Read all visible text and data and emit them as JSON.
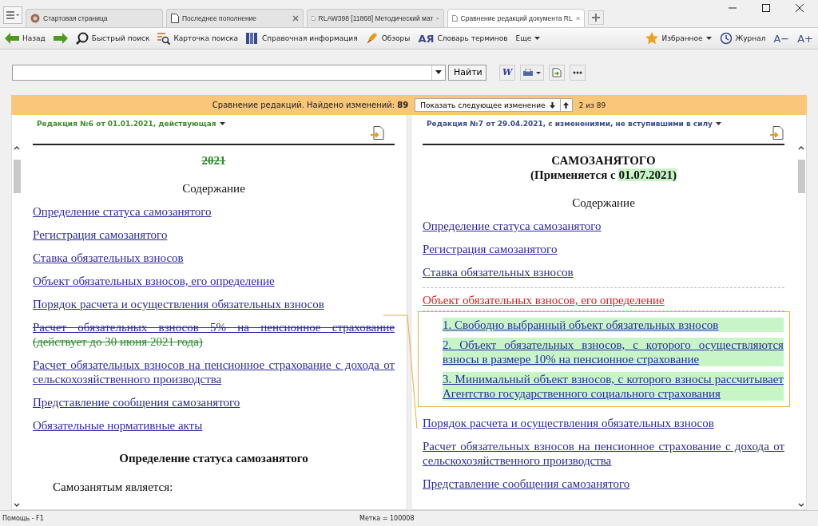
{
  "tabs": [
    {
      "label": "Стартовая страница",
      "kind": "home",
      "closable": false,
      "selected": false
    },
    {
      "label": "Последнее пополнение",
      "kind": "document",
      "closable": true,
      "selected": false
    },
    {
      "label": "RLAW398 [11868] Методический мат",
      "kind": "document",
      "closable": true,
      "selected": false
    },
    {
      "label": "Сравнение редакций документа RL",
      "kind": "document",
      "closable": true,
      "selected": true
    }
  ],
  "toolbar": {
    "left": [
      {
        "label": "Назад"
      },
      {
        "label": "Быстрый поиск"
      },
      {
        "label": "Карточка поиска"
      },
      {
        "label": "Справочная информация"
      },
      {
        "label": "Обзоры"
      },
      {
        "glyph": "АЯ",
        "label": "Словарь терминов"
      },
      {
        "label": "Еще"
      }
    ],
    "right": [
      {
        "label": "Избранное",
        "dropdown": true
      },
      {
        "label": "Журнал",
        "dropdown": false
      },
      {
        "label": "A−",
        "dropdown": false
      },
      {
        "label": "A+",
        "dropdown": false
      }
    ]
  },
  "search": {
    "button": "Найти",
    "word_glyph": "W"
  },
  "compare_bar": {
    "text": "Сравнение редакций. Найдено изменений: **89**",
    "next_button": "Показать следующее изменение",
    "position": "2 из 89"
  },
  "panes": [
    {
      "header": {
        "label": "Редакция №6 от 01.01.2021, действующая"
      },
      "blocks": [
        {
          "kind": "title",
          "segments": [
            {
              "text": "2021",
              "kind": "deleted"
            }
          ]
        },
        {
          "kind": "heading",
          "text": "Содержание"
        },
        {
          "kind": "link",
          "text": "Определение статуса самозанятого"
        },
        {
          "kind": "link",
          "text": "Регистрация самозанятого"
        },
        {
          "kind": "link",
          "text": "Ставка обязательных взносов"
        },
        {
          "kind": "link",
          "text": "Объект обязательных взносов, его определение"
        },
        {
          "kind": "link",
          "text": "Порядок расчета и осуществления обязательных взносов"
        },
        {
          "kind": "mixed",
          "segments": [
            {
              "text": "Расчет обязательных взносов 5% на пенсионное страхование ",
              "kind": "struck"
            },
            {
              "text": "(действует до 30 июня 2021 года)",
              "kind": "deleted"
            }
          ]
        },
        {
          "kind": "link",
          "text": "Расчет обязательных взносов на пенсионное страхование с дохода от сельскохозяйственного производства"
        },
        {
          "kind": "link",
          "text": "Представление сообщения самозанятого"
        },
        {
          "kind": "link",
          "text": "Обязательные нормативные акты"
        },
        {
          "kind": "section",
          "text": "Определение статуса самозанятого"
        },
        {
          "kind": "paragraph",
          "text": "Самозанятым является:"
        }
      ]
    },
    {
      "header": {
        "label": "Редакция №7 от 29.04.2021, с изменениями, не вступившими в силу"
      },
      "blocks": [
        {
          "kind": "title",
          "segments": [
            {
              "text": "САМОЗАНЯТОГО",
              "kind": "plain"
            }
          ]
        },
        {
          "kind": "title",
          "segments": [
            {
              "text": "(Применяется с ",
              "kind": "plain"
            },
            {
              "text": "01.07.2021)",
              "kind": "added"
            }
          ]
        },
        {
          "kind": "heading",
          "text": "Содержание"
        },
        {
          "kind": "link",
          "text": "Определение статуса самозанятого"
        },
        {
          "kind": "link",
          "text": "Регистрация самозанятого"
        },
        {
          "kind": "link",
          "text": "Ставка обязательных взносов"
        },
        {
          "kind": "changed",
          "text": "Объект обязательных взносов, его определение"
        },
        {
          "kind": "added-group",
          "items": [
            "1. Свободно выбранный объект обязательных взносов",
            "2. Объект обязательных взносов, с которого осуществляются взносы в размере 10% на пенсионное страхование",
            "3. Минимальный объект взносов, с которого взносы рассчитывает Агентство государственного социального страхования"
          ]
        },
        {
          "kind": "link",
          "text": "Порядок расчета и осуществления обязательных взносов"
        },
        {
          "kind": "link",
          "text": "Расчет обязательных взносов на пенсионное страхование с дохода от сельскохозяйственного производства"
        },
        {
          "kind": "link",
          "text": "Представление сообщения самозанятого"
        }
      ]
    }
  ],
  "status_bar": {
    "help": "Помощь - F1",
    "mark": "Метка = 100008"
  }
}
